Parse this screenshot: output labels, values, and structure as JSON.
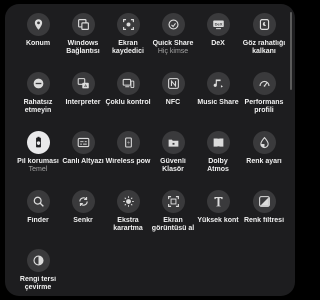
{
  "tiles": [
    {
      "name": "tile-konum",
      "label": "Konum",
      "icon": "location-pin-icon"
    },
    {
      "name": "tile-windows-baglantisi",
      "label": "Windows\nBağlantısı",
      "icon": "windows-link-icon"
    },
    {
      "name": "tile-ekran-kaydedici",
      "label": "Ekran\nkaydedici",
      "icon": "screen-recorder-icon"
    },
    {
      "name": "tile-quick-share",
      "label": "Quick Share",
      "sub": "Hiç kimse",
      "icon": "quick-share-icon"
    },
    {
      "name": "tile-dex",
      "label": "DeX",
      "icon": "dex-icon"
    },
    {
      "name": "tile-goz-rahatligi",
      "label": "Göz rahatlığı\nkalkanı",
      "icon": "eye-comfort-icon"
    },
    {
      "name": "tile-rahatsiz-etmeyin",
      "label": "Rahatsız\netmeyin",
      "icon": "do-not-disturb-icon"
    },
    {
      "name": "tile-interpreter",
      "label": "Interpreter",
      "icon": "interpreter-icon"
    },
    {
      "name": "tile-coklu-kontrol",
      "label": "Çoklu kontrol",
      "icon": "multi-control-icon"
    },
    {
      "name": "tile-nfc",
      "label": "NFC",
      "icon": "nfc-icon"
    },
    {
      "name": "tile-music-share",
      "label": "Music Share",
      "icon": "music-share-icon"
    },
    {
      "name": "tile-performans-profili",
      "label": "Performans\nprofili",
      "icon": "performance-icon"
    },
    {
      "name": "tile-pil-korumasi",
      "label": "Pil koruması",
      "sub": "Temel",
      "icon": "battery-shield-icon",
      "active": true
    },
    {
      "name": "tile-canli-altyazi",
      "label": "Canlı Altyazı",
      "icon": "live-caption-icon"
    },
    {
      "name": "tile-wireless-power",
      "label": "Wireless pow",
      "icon": "wireless-power-icon"
    },
    {
      "name": "tile-guvenli-klasor",
      "label": "Güvenli\nKlasör",
      "icon": "secure-folder-icon"
    },
    {
      "name": "tile-dolby-atmos",
      "label": "Dolby\nAtmos",
      "icon": "dolby-icon"
    },
    {
      "name": "tile-renk-ayari",
      "label": "Renk ayarı",
      "icon": "color-adjust-icon"
    },
    {
      "name": "tile-finder",
      "label": "Finder",
      "icon": "search-icon"
    },
    {
      "name": "tile-senkr",
      "label": "Senkr",
      "icon": "sync-icon"
    },
    {
      "name": "tile-ekstra-karartma",
      "label": "Ekstra\nkarartma",
      "icon": "extra-dim-icon"
    },
    {
      "name": "tile-ekran-goruntusu",
      "label": "Ekran\ngörüntüsü al",
      "icon": "screenshot-icon"
    },
    {
      "name": "tile-yuksek-kontrast",
      "label": "Yüksek kont",
      "icon": "font-t-icon"
    },
    {
      "name": "tile-renk-filtresi",
      "label": "Renk filtresi",
      "icon": "color-filter-icon"
    },
    {
      "name": "tile-rengi-ters-cevirme",
      "label": "Rengi tersi\nçevirme",
      "icon": "invert-colors-icon"
    }
  ]
}
